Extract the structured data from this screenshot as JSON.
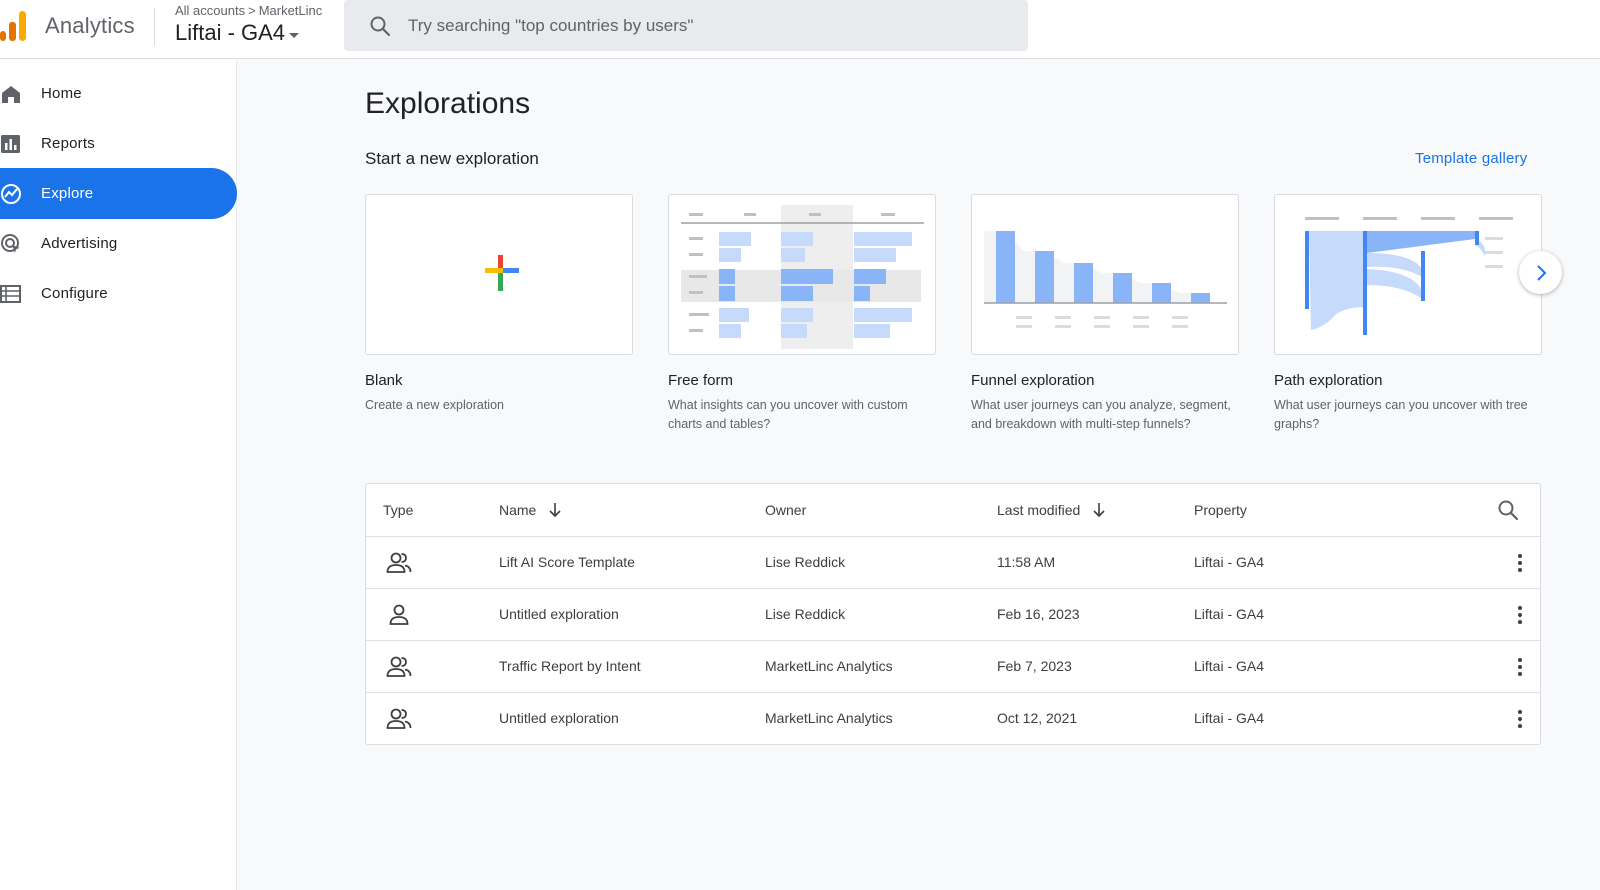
{
  "header": {
    "app_name": "Analytics",
    "breadcrumb": {
      "parent": "All accounts",
      "separator": ">",
      "account": "MarketLinc"
    },
    "property": "Liftai - GA4",
    "search_placeholder": "Try searching \"top countries by users\""
  },
  "colors": {
    "accent": "#1a73e8",
    "logo_orange": "#f9ab00",
    "logo_dark_orange": "#e37400",
    "chart_blue": "#8ab4f8"
  },
  "sidebar": {
    "items": [
      {
        "label": "Home",
        "icon": "home-icon",
        "active": false
      },
      {
        "label": "Reports",
        "icon": "reports-icon",
        "active": false
      },
      {
        "label": "Explore",
        "icon": "explore-icon",
        "active": true
      },
      {
        "label": "Advertising",
        "icon": "advertising-icon",
        "active": false
      },
      {
        "label": "Configure",
        "icon": "configure-icon",
        "active": false
      }
    ]
  },
  "main": {
    "title": "Explorations",
    "section_title": "Start a new exploration",
    "template_gallery": "Template gallery",
    "cards": [
      {
        "title": "Blank",
        "description": "Create a new exploration"
      },
      {
        "title": "Free form",
        "description": "What insights can you uncover with custom charts and tables?"
      },
      {
        "title": "Funnel exploration",
        "description": "What user journeys can you analyze, segment, and breakdown with multi-step funnels?"
      },
      {
        "title": "Path exploration",
        "description": "What user journeys can you uncover with tree graphs?"
      }
    ]
  },
  "table": {
    "columns": {
      "type": "Type",
      "name": "Name",
      "owner": "Owner",
      "last_modified": "Last modified",
      "property": "Property"
    },
    "rows": [
      {
        "type_icon": "shared-users-icon",
        "name": "Lift AI Score Template",
        "owner": "Lise Reddick",
        "last_modified": "11:58 AM",
        "property": "Liftai - GA4"
      },
      {
        "type_icon": "single-user-icon",
        "name": "Untitled exploration",
        "owner": "Lise Reddick",
        "last_modified": "Feb 16, 2023",
        "property": "Liftai - GA4"
      },
      {
        "type_icon": "shared-users-icon",
        "name": "Traffic Report by Intent",
        "owner": "MarketLinc Analytics",
        "last_modified": "Feb 7, 2023",
        "property": "Liftai - GA4"
      },
      {
        "type_icon": "shared-users-icon",
        "name": "Untitled exploration",
        "owner": "MarketLinc Analytics",
        "last_modified": "Oct 12, 2021",
        "property": "Liftai - GA4"
      }
    ]
  }
}
